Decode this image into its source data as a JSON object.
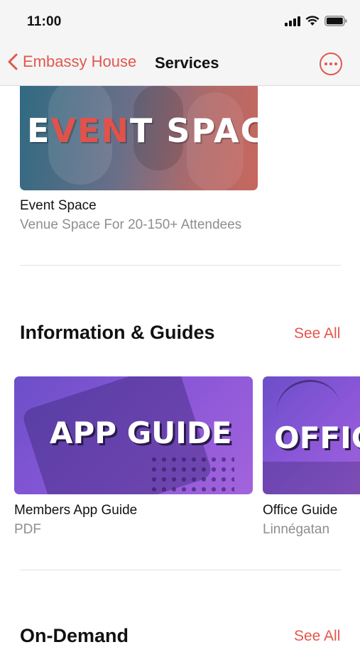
{
  "status_bar": {
    "time": "11:00"
  },
  "nav": {
    "back_label": "Embassy House",
    "title": "Services"
  },
  "event_card": {
    "art_text_part1": "E",
    "art_text_part2": "VEN",
    "art_text_part3": "T SPACE",
    "title": "Event Space",
    "subtitle": "Venue Space For 20-150+ Attendees"
  },
  "info_section": {
    "title": "Information & Guides",
    "see_all": "See All",
    "cards": [
      {
        "art_text": "APP GUIDE",
        "title": "Members App Guide",
        "subtitle": "PDF"
      },
      {
        "art_text": "OFFIC",
        "title": "Office Guide",
        "subtitle": "Linnégatan"
      }
    ]
  },
  "ondemand_section": {
    "title": "On-Demand",
    "see_all": "See All"
  },
  "colors": {
    "accent": "#e2574c",
    "secondary_text": "#8e8e93"
  }
}
